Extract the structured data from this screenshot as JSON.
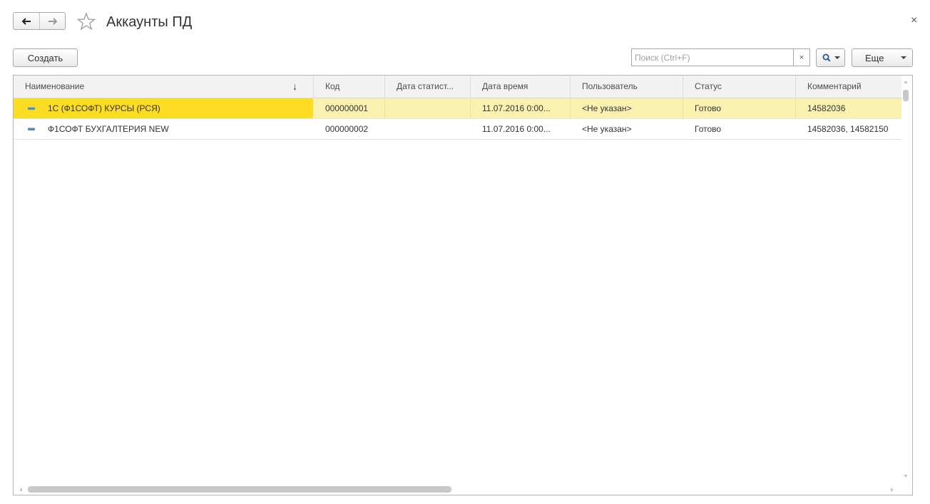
{
  "window": {
    "title": "Аккаунты ПД",
    "close_glyph": "×"
  },
  "nav": {
    "back_icon": "arrow-left-icon",
    "forward_icon": "arrow-right-icon",
    "favorite_icon": "star-icon"
  },
  "toolbar": {
    "create_label": "Создать",
    "search_placeholder": "Поиск (Ctrl+F)",
    "search_value": "",
    "clear_glyph": "×",
    "search_icon": "magnifier-icon",
    "more_label": "Еще"
  },
  "table": {
    "columns": [
      "Наименование",
      "Код",
      "Дата статист...",
      "Дата время",
      "Пользователь",
      "Статус",
      "Комментарий"
    ],
    "sort_indicator": "↓",
    "rows": [
      {
        "name": "1С (Ф1СОФТ) КУРСЫ (РСЯ)",
        "code": "000000001",
        "stat_date": "",
        "datetime": "11.07.2016 0:00...",
        "user": "<Не указан>",
        "status": "Готово",
        "comment": "14582036",
        "selected": true
      },
      {
        "name": "Ф1СОФТ БУХГАЛТЕРИЯ NEW",
        "code": "000000002",
        "stat_date": "",
        "datetime": "11.07.2016 0:00...",
        "user": "<Не указан>",
        "status": "Готово",
        "comment": "14582036, 14582150",
        "selected": false
      }
    ]
  },
  "colors": {
    "selected_row": "#fbf1b0",
    "selected_cell": "#fcdd24",
    "header_bg": "#f2f2f2"
  }
}
